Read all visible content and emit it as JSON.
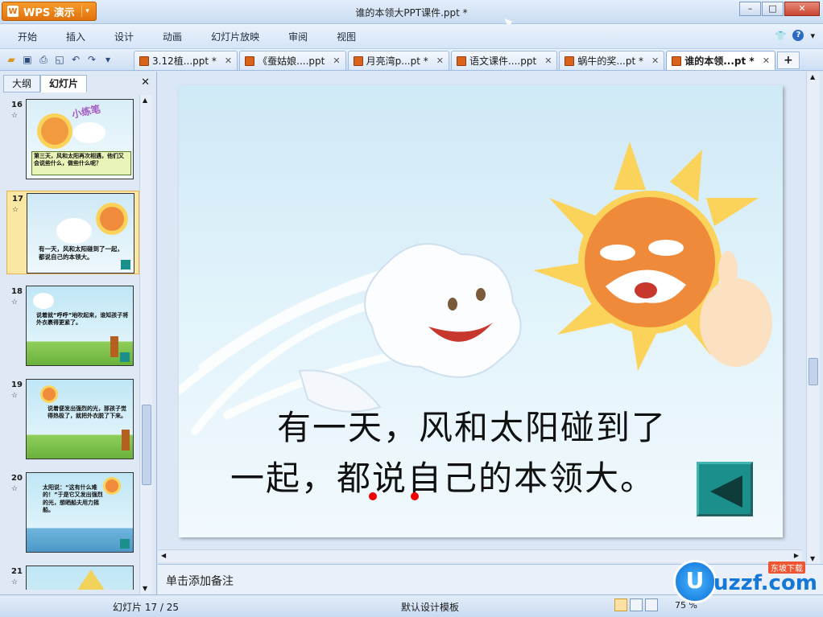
{
  "app": {
    "brand": "WPS 演示",
    "doc_title": "谁的本领大PPT课件.ppt *"
  },
  "menu": [
    "开始",
    "插入",
    "设计",
    "动画",
    "幻灯片放映",
    "审阅",
    "视图"
  ],
  "tabs": [
    {
      "label": "3.12植...ppt *"
    },
    {
      "label": "《蚕姑娘....ppt"
    },
    {
      "label": "月亮湾p...pt *"
    },
    {
      "label": "语文课件....ppt"
    },
    {
      "label": "蜗牛的奖...pt *"
    },
    {
      "label": "谁的本领...pt *"
    }
  ],
  "panel": {
    "tab_outline": "大纲",
    "tab_slides": "幻灯片",
    "thumbnails": [
      {
        "num": "16",
        "caption": "第三天，风和太阳再次相遇，他们又会说些什么，做些什么呢？",
        "title": "小练笔"
      },
      {
        "num": "17",
        "caption": "有一天，风和太阳碰到了一起，都说自己的本领大。"
      },
      {
        "num": "18",
        "caption": "说着就“呼呼”地吹起来，谁知孩子将外衣裹得更紧了。"
      },
      {
        "num": "19",
        "caption": "说着便发出强烈的光，那孩子觉得热极了，就把外衣脱了下来。"
      },
      {
        "num": "20",
        "caption": "太阳说：“这有什么难的！”于是它又发出强烈的光，想晒船夫用力摇船。"
      },
      {
        "num": "21",
        "caption": ""
      }
    ]
  },
  "slide": {
    "line1": "有一天，风和太阳碰到了",
    "line2": "一起，都说自己的本领大。"
  },
  "notes_placeholder": "单击添加备注",
  "status": {
    "slide_counter": "幻灯片 17 / 25",
    "template": "默认设计模板",
    "zoom": "75 %"
  },
  "watermark": {
    "text": "uzzf.com",
    "sub": "东坡下载"
  }
}
